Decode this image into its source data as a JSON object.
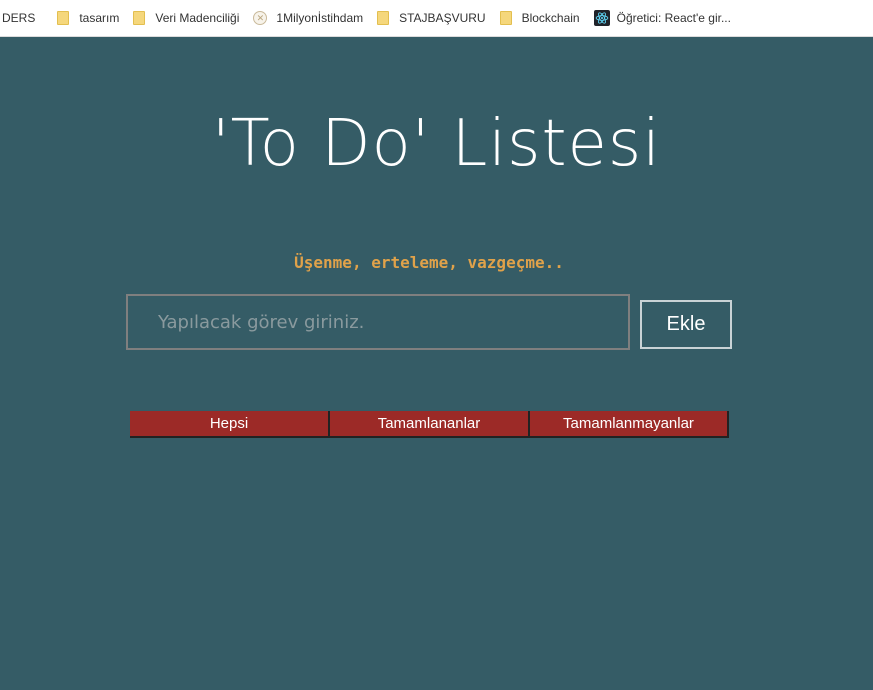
{
  "bookmarks": {
    "items": [
      {
        "label": "DERS",
        "icon": "none"
      },
      {
        "label": "tasarım",
        "icon": "folder-icon"
      },
      {
        "label": "Veri Madenciliği",
        "icon": "folder-icon"
      },
      {
        "label": "1Milyonİstihdam",
        "icon": "site-icon"
      },
      {
        "label": "STAJBAŞVURU",
        "icon": "folder-icon"
      },
      {
        "label": "Blockchain",
        "icon": "folder-icon"
      },
      {
        "label": "Öğretici: React'e gir...",
        "icon": "react-icon"
      }
    ]
  },
  "app": {
    "title": "'To Do' Listesi",
    "motto": "Üşenme, erteleme, vazgeçme..",
    "input_placeholder": "Yapılacak görev giriniz.",
    "add_label": "Ekle",
    "filters": [
      {
        "label": "Hepsi"
      },
      {
        "label": "Tamamlananlar"
      },
      {
        "label": "Tamamlanmayanlar"
      }
    ]
  },
  "colors": {
    "background": "#355c66",
    "motto": "#e0a24a",
    "filter_button": "#9c2a27",
    "folder": "#f5d77c"
  }
}
